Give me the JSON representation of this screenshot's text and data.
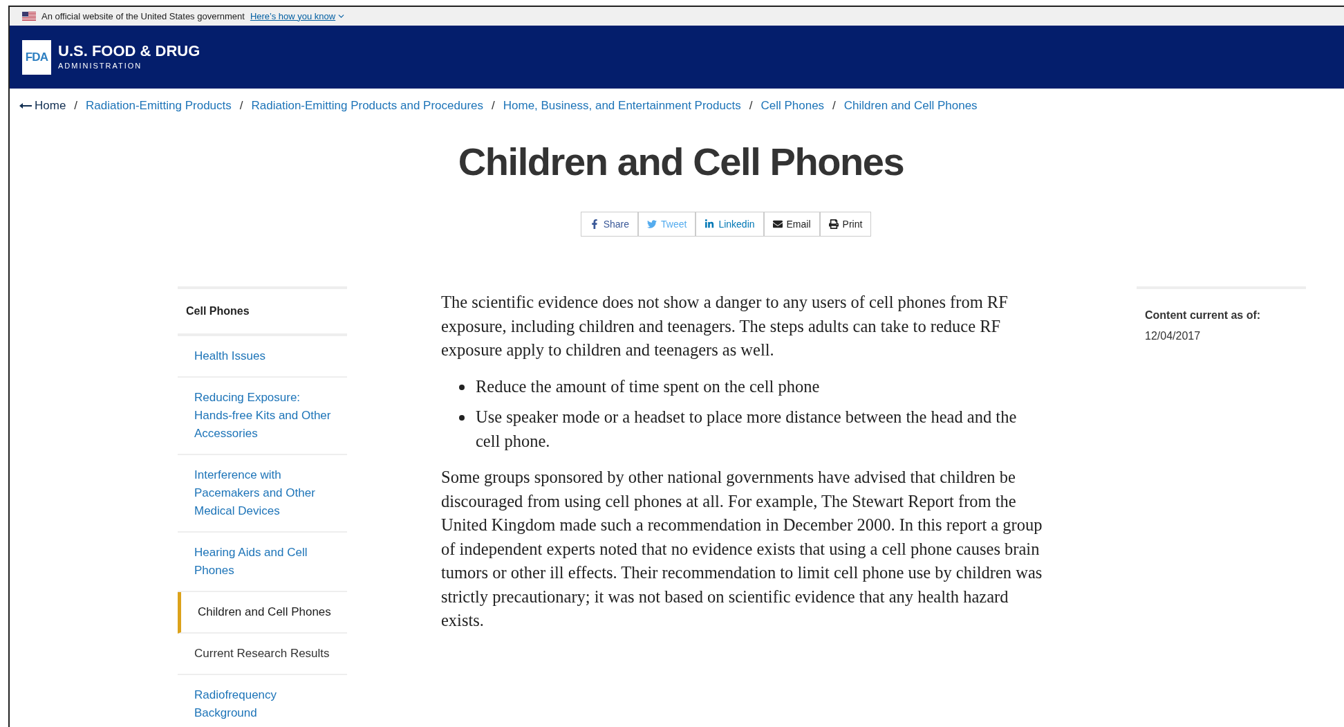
{
  "gov_banner": {
    "text": "An official website of the United States government",
    "link": "Here’s how you know"
  },
  "header": {
    "logo_text": "FDA",
    "title": "U.S. FOOD & DRUG",
    "subtitle": "ADMINISTRATION"
  },
  "breadcrumb": {
    "separator": "/",
    "links": [
      "Home",
      "Radiation-Emitting Products",
      "Radiation-Emitting Products and Procedures",
      "Home, Business, and Entertainment Products",
      "Cell Phones",
      "Children and Cell Phones"
    ]
  },
  "page_title": "Children and Cell Phones",
  "share_buttons": [
    {
      "kind": "facebook",
      "label": "Share"
    },
    {
      "kind": "twitter",
      "label": "Tweet"
    },
    {
      "kind": "linkedin",
      "label": "Linkedin"
    },
    {
      "kind": "email",
      "label": "Email"
    },
    {
      "kind": "print",
      "label": "Print"
    }
  ],
  "sidebar": {
    "title": "Cell Phones",
    "items": [
      {
        "label": "Health Issues",
        "selected": false,
        "visited": false
      },
      {
        "label": "Reducing Exposure: Hands-free Kits and Other Accessories",
        "selected": false,
        "visited": false
      },
      {
        "label": "Interference with Pacemakers and Other Medical Devices",
        "selected": false,
        "visited": false
      },
      {
        "label": "Hearing Aids and Cell Phones",
        "selected": false,
        "visited": false
      },
      {
        "label": "Children and Cell Phones",
        "selected": true,
        "visited": false
      },
      {
        "label": "Current Research Results",
        "selected": false,
        "visited": true
      },
      {
        "label": "Radiofrequency Background",
        "selected": false,
        "visited": false
      }
    ]
  },
  "content": [
    {
      "kind": "paragraph",
      "text": "The scientific evidence does not show a danger to any users of cell phones from RF exposure, including children and teenagers. The steps adults can take to reduce RF exposure apply to children and teenagers as well."
    },
    {
      "kind": "list",
      "items": [
        "Reduce the amount of time spent on the cell phone",
        "Use speaker mode or a headset to place more distance between the head and the cell phone."
      ]
    },
    {
      "kind": "paragraph",
      "text": "Some groups sponsored by other national governments have advised that children be discouraged from using cell phones at all. For example, The Stewart Report from the United Kingdom made such a recommendation in December 2000. In this report a group of independent experts noted that no evidence exists that using a cell phone causes brain tumors or other ill effects. Their recommendation to limit cell phone use by children was strictly precautionary; it was not based on scientific evidence that any health hazard exists."
    }
  ],
  "aside": {
    "label": "Content current as of:",
    "date": "12/04/2017"
  }
}
